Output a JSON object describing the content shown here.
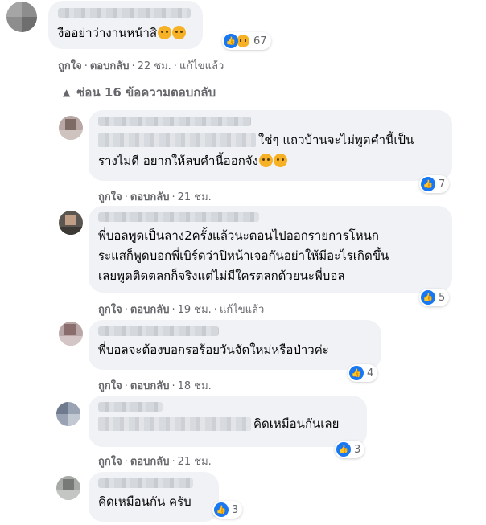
{
  "top_comment": {
    "text": "งืออย่าว่างานหน้าสิ",
    "reaction_count": "67",
    "actions": {
      "like": "ถูกใจ",
      "reply": "ตอบกลับ",
      "time": "22 ชม.",
      "edited": "แก้ไขแล้ว"
    }
  },
  "replies_toggle": {
    "label": "ซ่อน 16 ข้อความตอบกลับ",
    "icon": "chevron-up-icon"
  },
  "replies": [
    {
      "lines": [
        "ใช่ๆ แถวบ้านจะไม่พูดคำนี้เป็น",
        "รางไม่ดี อยากให้ลบคำนี้ออกจัง"
      ],
      "reaction_count": "7",
      "actions": {
        "like": "ถูกใจ",
        "reply": "ตอบกลับ",
        "time": "21 ชม."
      }
    },
    {
      "lines": [
        "พี่บอลพูดเป็นลาง2ครั้งแล้วนะตอนไปออกรายการโหนก",
        "ระแสก็พูดบอกพี่เบิร์ดว่าปีหน้าเจอกันอย่าให้มีอะไรเกิดขึ้น",
        "เลยพูดติดตลกก็จริงแต่ไม่มีใครตลกด้วยนะพี่บอล"
      ],
      "reaction_count": "5",
      "actions": {
        "like": "ถูกใจ",
        "reply": "ตอบกลับ",
        "time": "19 ชม.",
        "edited": "แก้ไขแล้ว"
      }
    },
    {
      "lines": [
        "พี่บอลจะต้องบอกรอร้อยวันจัดใหม่หรือป่าวค่ะ"
      ],
      "reaction_count": "4",
      "actions": {
        "like": "ถูกใจ",
        "reply": "ตอบกลับ",
        "time": "18 ชม."
      }
    },
    {
      "lines": [
        "คิดเหมือนกันเลย"
      ],
      "reaction_count": "3",
      "actions": {
        "like": "ถูกใจ",
        "reply": "ตอบกลับ",
        "time": "21 ชม."
      }
    },
    {
      "lines": [
        "คิดเหมือนกัน ครับ"
      ],
      "reaction_count": "3"
    }
  ],
  "colors": {
    "like_blue": "#1877f2",
    "bubble": "#f0f2f5",
    "meta": "#65676b"
  }
}
